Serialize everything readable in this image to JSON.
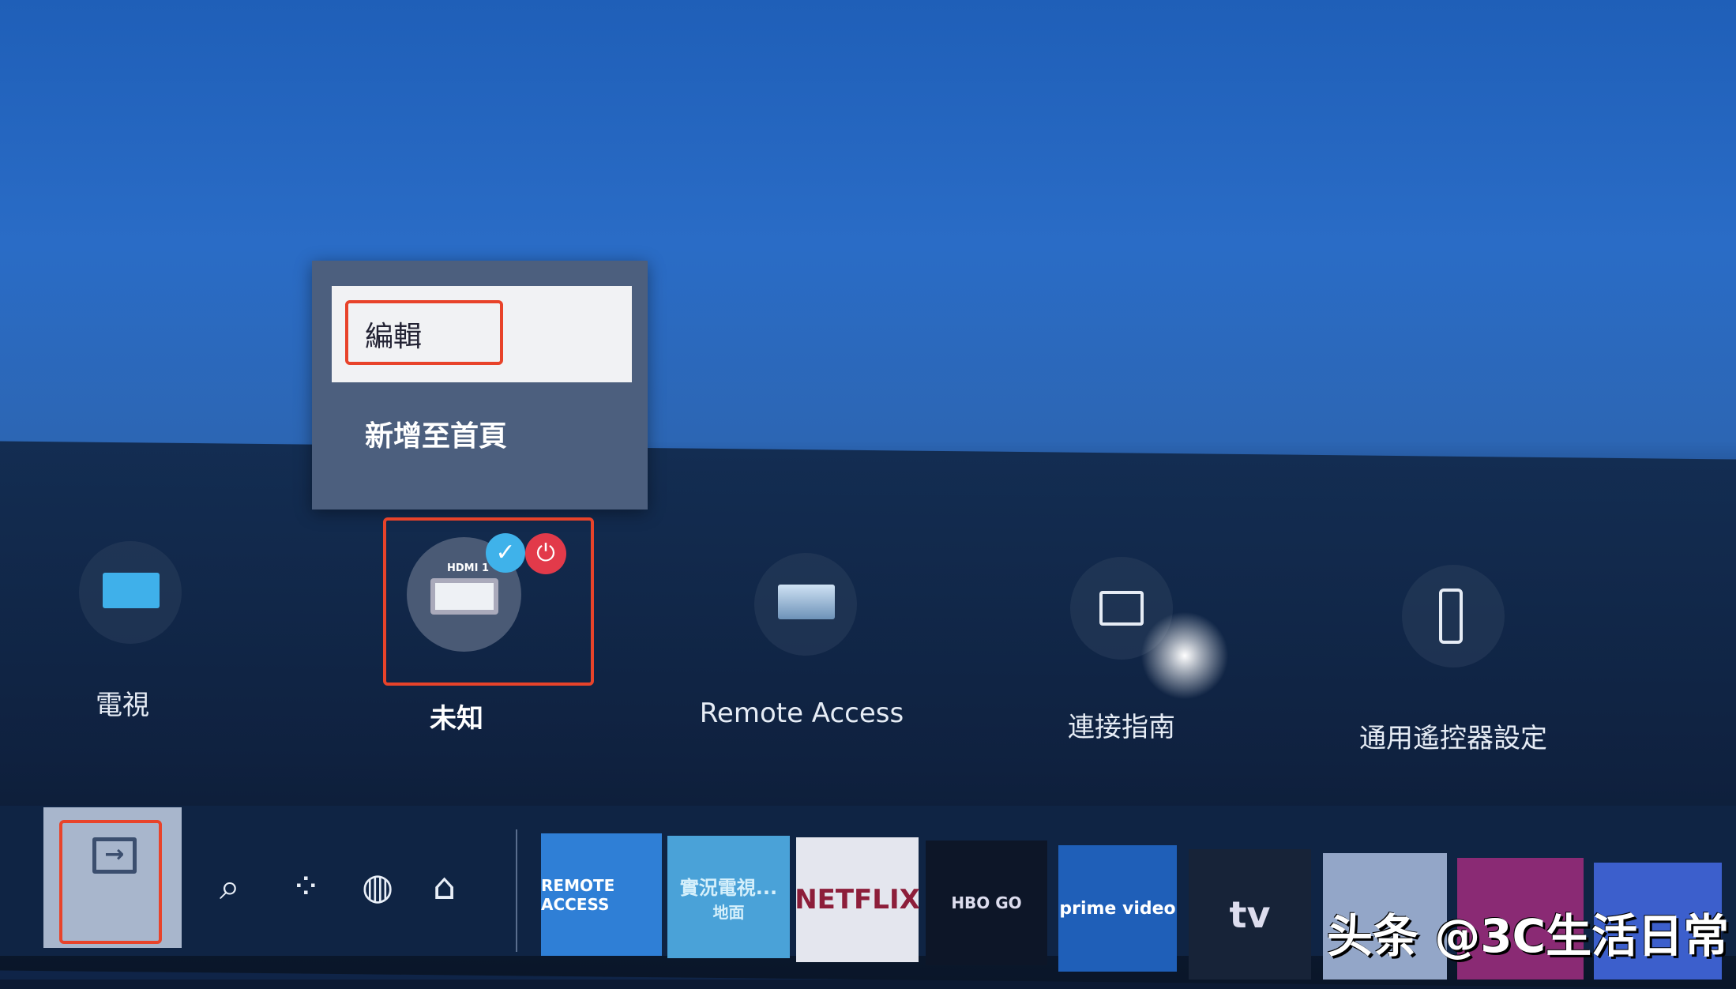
{
  "context_menu": {
    "items": [
      {
        "label": "編輯",
        "selected": true
      },
      {
        "label": "新增至首頁",
        "selected": false
      }
    ]
  },
  "sources": [
    {
      "label": "電視",
      "icon": "tv-icon"
    },
    {
      "label": "未知",
      "icon": "hdmi-icon",
      "badge": "HDMI 1",
      "selected": true
    },
    {
      "label": "Remote Access",
      "icon": "remote-access-icon"
    },
    {
      "label": "連接指南",
      "icon": "connection-guide-icon"
    },
    {
      "label": "通用遙控器設定",
      "icon": "remote-control-icon"
    }
  ],
  "bottom_bar": {
    "nav": [
      "source-icon",
      "search-icon",
      "apps-icon",
      "ambient-icon",
      "home-icon"
    ],
    "apps": [
      {
        "label": "REMOTE ACCESS",
        "color": "#2f7fd6"
      },
      {
        "label": "實況電視...",
        "sub": "地面",
        "color": "#4aa2d8"
      },
      {
        "label": "NETFLIX",
        "color": "#e4e6ee",
        "text_color": "#8d1e3a"
      },
      {
        "label": "HBO GO",
        "color": "#0d1628"
      },
      {
        "label": "prime video",
        "color": "#1f5fb8"
      },
      {
        "label": "tv",
        "color": "#172338"
      },
      {
        "label": "",
        "color": "#93a6c8"
      },
      {
        "label": "",
        "color": "#8a2a74"
      },
      {
        "label": "",
        "color": "#3c5fcc"
      }
    ]
  },
  "highlight_color": "#e8432a",
  "watermark": "头条 @3C生活日常"
}
